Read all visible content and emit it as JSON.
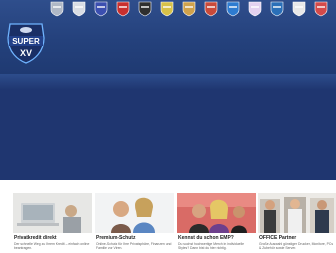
{
  "brand": {
    "line1": "SUPER",
    "line2": "XV"
  },
  "teams": [
    {
      "name": "team-1",
      "color": "#b0b8c6"
    },
    {
      "name": "team-2",
      "color": "#d9dde4"
    },
    {
      "name": "team-3",
      "color": "#3b4fb0"
    },
    {
      "name": "team-4",
      "color": "#c8302f"
    },
    {
      "name": "team-5",
      "color": "#2f2f2f"
    },
    {
      "name": "team-6",
      "color": "#d7c148"
    },
    {
      "name": "team-7",
      "color": "#d0a24c"
    },
    {
      "name": "team-8",
      "color": "#c94a3a"
    },
    {
      "name": "team-9",
      "color": "#2e7bd0"
    },
    {
      "name": "team-10",
      "color": "#e3d2f0"
    },
    {
      "name": "team-11",
      "color": "#2a6fb8"
    },
    {
      "name": "team-12",
      "color": "#e8e8e8"
    },
    {
      "name": "team-13",
      "color": "#d34a4a"
    }
  ],
  "cards": [
    {
      "title": "Privatkredit direkt",
      "desc": "Der schnelle Weg zu Ihrem Kredit – einfach online beantragen."
    },
    {
      "title": "Premium-Schutz",
      "desc": "Online-Schutz für Ihre Privatsphäre, Finanzen und Familie vor Viren."
    },
    {
      "title": "Kennst du schon EMP?",
      "desc": "Du suchst hochwertige Merch in individuelle Styles? Dann bist du hier richtig."
    },
    {
      "title": "OFFICE Partner",
      "desc": "Große Auswahl günstiger Drucker, Monitore, PCs & Zubehör sowie Server."
    }
  ]
}
